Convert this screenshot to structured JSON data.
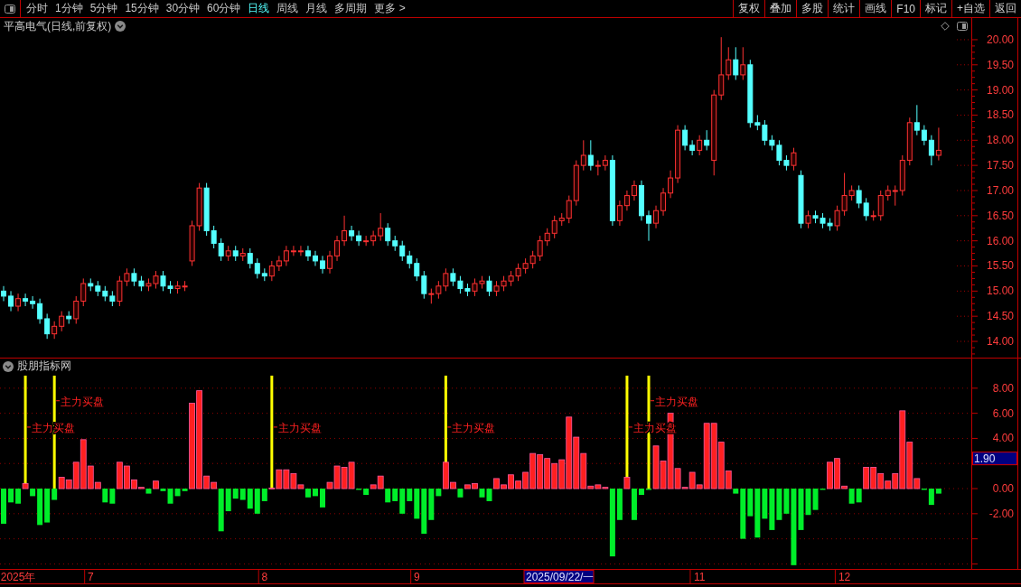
{
  "toolbar": {
    "tabs": [
      {
        "label": "分时",
        "selected": false
      },
      {
        "label": "1分钟",
        "selected": false
      },
      {
        "label": "5分钟",
        "selected": false
      },
      {
        "label": "15分钟",
        "selected": false
      },
      {
        "label": "30分钟",
        "selected": false
      },
      {
        "label": "60分钟",
        "selected": false
      },
      {
        "label": "日线",
        "selected": true
      },
      {
        "label": "周线",
        "selected": false
      },
      {
        "label": "月线",
        "selected": false
      },
      {
        "label": "多周期",
        "selected": false
      },
      {
        "label": "更多 >",
        "selected": false
      }
    ],
    "buttons": [
      "复权",
      "叠加",
      "多股",
      "统计",
      "画线",
      "F10",
      "标记",
      "+自选",
      "返回"
    ]
  },
  "main_chart": {
    "title": "平高电气(日线,前复权)",
    "chart_data": {
      "type": "candlestick",
      "ylim": [
        13.677,
        20.43
      ],
      "yticks": [
        {
          "value": 14,
          "label": "14.00"
        },
        {
          "value": 14.5,
          "label": "14.50"
        },
        {
          "value": 15,
          "label": "15.00"
        },
        {
          "value": 15.5,
          "label": "15.50"
        },
        {
          "value": 16,
          "label": "16.00"
        },
        {
          "value": 16.5,
          "label": "16.50"
        },
        {
          "value": 17,
          "label": "17.00"
        },
        {
          "value": 17.5,
          "label": "17.50"
        },
        {
          "value": 18,
          "label": "18.00"
        },
        {
          "value": 18.5,
          "label": "18.50"
        },
        {
          "value": 19,
          "label": "19.00"
        },
        {
          "value": 19.5,
          "label": "19.50"
        },
        {
          "value": 20,
          "label": "20.00"
        }
      ],
      "categories": [
        null,
        null,
        null,
        null,
        null,
        null,
        null,
        null,
        null,
        null,
        null,
        null,
        null,
        null,
        null,
        null,
        null,
        null,
        null,
        null,
        null,
        null,
        null,
        null,
        null,
        null,
        null,
        null,
        null,
        null,
        null,
        null,
        null,
        null,
        null,
        null,
        null,
        null,
        null,
        null,
        null,
        null,
        null,
        null,
        null,
        null,
        null,
        null,
        null,
        null,
        null,
        null,
        null,
        null,
        null,
        null,
        null,
        null,
        null,
        null,
        null,
        null,
        null,
        null,
        null,
        null,
        null,
        null,
        null,
        null,
        null,
        null,
        null,
        null,
        null,
        null,
        null,
        null,
        null,
        null,
        null,
        null,
        null,
        null,
        null,
        null,
        null,
        null,
        null,
        null,
        null,
        null,
        null,
        null,
        null,
        null,
        null,
        null,
        null,
        null,
        null,
        null,
        null,
        null,
        null,
        null,
        null,
        null,
        null,
        null,
        null,
        null,
        null,
        null,
        null,
        null,
        null,
        null,
        null,
        null,
        null,
        null,
        null,
        null,
        null,
        null,
        null,
        null,
        null,
        null
      ],
      "ohlc": [
        [
          15.0,
          15.1,
          14.8,
          14.9
        ],
        [
          14.9,
          15.0,
          14.6,
          14.7
        ],
        [
          14.7,
          14.95,
          14.6,
          14.85
        ],
        [
          14.85,
          14.95,
          14.7,
          14.8
        ],
        [
          14.8,
          14.9,
          14.65,
          14.75
        ],
        [
          14.75,
          14.85,
          14.35,
          14.45
        ],
        [
          14.45,
          14.55,
          14.05,
          14.15
        ],
        [
          14.15,
          14.4,
          14.05,
          14.3
        ],
        [
          14.3,
          14.6,
          14.2,
          14.5
        ],
        [
          14.5,
          14.6,
          14.35,
          14.45
        ],
        [
          14.45,
          14.9,
          14.35,
          14.8
        ],
        [
          14.8,
          15.25,
          14.7,
          15.15
        ],
        [
          15.15,
          15.25,
          15.0,
          15.1
        ],
        [
          15.1,
          15.2,
          14.9,
          15.0
        ],
        [
          15.0,
          15.1,
          14.8,
          14.9
        ],
        [
          14.9,
          15.0,
          14.7,
          14.8
        ],
        [
          14.8,
          15.3,
          14.7,
          15.2
        ],
        [
          15.2,
          15.45,
          15.1,
          15.35
        ],
        [
          15.35,
          15.45,
          15.1,
          15.2
        ],
        [
          15.2,
          15.3,
          15.0,
          15.1
        ],
        [
          15.1,
          15.25,
          15.0,
          15.15
        ],
        [
          15.15,
          15.4,
          15.05,
          15.3
        ],
        [
          15.3,
          15.4,
          15.0,
          15.1
        ],
        [
          15.1,
          15.2,
          14.95,
          15.05
        ],
        [
          15.05,
          15.2,
          14.95,
          15.1
        ],
        [
          15.1,
          15.2,
          15.0,
          15.1
        ],
        [
          15.6,
          16.4,
          15.5,
          16.3
        ],
        [
          16.3,
          17.15,
          16.2,
          17.05
        ],
        [
          17.05,
          17.15,
          16.1,
          16.2
        ],
        [
          16.2,
          16.3,
          15.85,
          15.95
        ],
        [
          15.95,
          16.05,
          15.6,
          15.7
        ],
        [
          15.7,
          15.9,
          15.6,
          15.8
        ],
        [
          15.8,
          15.9,
          15.6,
          15.7
        ],
        [
          15.7,
          15.85,
          15.6,
          15.75
        ],
        [
          15.75,
          15.85,
          15.45,
          15.55
        ],
        [
          15.55,
          15.65,
          15.25,
          15.35
        ],
        [
          15.35,
          15.45,
          15.2,
          15.3
        ],
        [
          15.3,
          15.6,
          15.2,
          15.5
        ],
        [
          15.5,
          15.7,
          15.4,
          15.6
        ],
        [
          15.6,
          15.9,
          15.5,
          15.8
        ],
        [
          15.8,
          15.9,
          15.7,
          15.8
        ],
        [
          15.8,
          15.9,
          15.7,
          15.8
        ],
        [
          15.8,
          15.9,
          15.6,
          15.7
        ],
        [
          15.7,
          15.8,
          15.5,
          15.6
        ],
        [
          15.6,
          15.7,
          15.35,
          15.45
        ],
        [
          15.45,
          15.8,
          15.35,
          15.7
        ],
        [
          15.7,
          16.1,
          15.6,
          16.0
        ],
        [
          16.0,
          16.5,
          15.9,
          16.2
        ],
        [
          16.2,
          16.3,
          16.0,
          16.1
        ],
        [
          16.1,
          16.2,
          15.9,
          16.0
        ],
        [
          16.0,
          16.1,
          15.9,
          16.0
        ],
        [
          16.0,
          16.2,
          15.9,
          16.1
        ],
        [
          16.1,
          16.55,
          16.0,
          16.25
        ],
        [
          16.25,
          16.35,
          15.9,
          16.0
        ],
        [
          16.0,
          16.1,
          15.8,
          15.9
        ],
        [
          15.9,
          16.0,
          15.6,
          15.7
        ],
        [
          15.7,
          15.8,
          15.45,
          15.55
        ],
        [
          15.55,
          15.65,
          15.2,
          15.3
        ],
        [
          15.3,
          15.4,
          14.85,
          14.95
        ],
        [
          14.95,
          15.05,
          14.75,
          14.95
        ],
        [
          14.95,
          15.2,
          14.85,
          15.1
        ],
        [
          15.1,
          15.45,
          15.0,
          15.35
        ],
        [
          15.35,
          15.45,
          15.1,
          15.2
        ],
        [
          15.2,
          15.3,
          14.95,
          15.05
        ],
        [
          15.05,
          15.15,
          14.9,
          15.0
        ],
        [
          15.0,
          15.25,
          14.9,
          15.15
        ],
        [
          15.15,
          15.3,
          15.05,
          15.2
        ],
        [
          15.2,
          15.3,
          14.9,
          15.0
        ],
        [
          15.0,
          15.2,
          14.9,
          15.1
        ],
        [
          15.1,
          15.3,
          15.0,
          15.2
        ],
        [
          15.2,
          15.4,
          15.1,
          15.3
        ],
        [
          15.3,
          15.55,
          15.2,
          15.45
        ],
        [
          15.45,
          15.65,
          15.35,
          15.55
        ],
        [
          15.55,
          15.8,
          15.45,
          15.7
        ],
        [
          15.7,
          16.1,
          15.6,
          16.0
        ],
        [
          16.0,
          16.25,
          15.9,
          16.15
        ],
        [
          16.15,
          16.5,
          16.05,
          16.4
        ],
        [
          16.4,
          16.55,
          16.3,
          16.45
        ],
        [
          16.45,
          16.9,
          16.35,
          16.8
        ],
        [
          16.8,
          17.6,
          16.7,
          17.5
        ],
        [
          17.5,
          18.0,
          17.4,
          17.7
        ],
        [
          17.7,
          18.0,
          17.4,
          17.5
        ],
        [
          17.5,
          17.6,
          17.3,
          17.5
        ],
        [
          17.5,
          17.7,
          17.4,
          17.6
        ],
        [
          17.6,
          17.7,
          16.3,
          16.4
        ],
        [
          16.4,
          16.8,
          16.3,
          16.7
        ],
        [
          16.7,
          17.0,
          16.6,
          16.9
        ],
        [
          16.9,
          17.2,
          16.8,
          17.1
        ],
        [
          17.1,
          17.2,
          16.4,
          16.5
        ],
        [
          16.5,
          16.6,
          16.0,
          16.35
        ],
        [
          16.35,
          16.7,
          16.25,
          16.6
        ],
        [
          16.6,
          17.05,
          16.5,
          16.95
        ],
        [
          16.95,
          17.4,
          16.85,
          17.25
        ],
        [
          17.25,
          18.3,
          17.15,
          18.2
        ],
        [
          18.2,
          18.3,
          17.8,
          17.9
        ],
        [
          17.9,
          18.0,
          17.7,
          17.8
        ],
        [
          17.8,
          18.1,
          17.7,
          18.0
        ],
        [
          18.0,
          18.2,
          17.8,
          17.9
        ],
        [
          17.6,
          19.0,
          17.3,
          18.9
        ],
        [
          18.9,
          20.05,
          18.8,
          19.3
        ],
        [
          19.3,
          19.85,
          19.2,
          19.6
        ],
        [
          19.6,
          19.85,
          19.2,
          19.3
        ],
        [
          19.3,
          19.85,
          19.2,
          19.5
        ],
        [
          19.5,
          19.6,
          18.25,
          18.35
        ],
        [
          18.35,
          18.5,
          18.2,
          18.3
        ],
        [
          18.3,
          18.4,
          17.9,
          18.0
        ],
        [
          18.0,
          18.1,
          17.8,
          17.9
        ],
        [
          17.9,
          18.0,
          17.5,
          17.6
        ],
        [
          17.6,
          17.7,
          17.4,
          17.5
        ],
        [
          17.5,
          17.85,
          17.4,
          17.75
        ],
        [
          17.3,
          17.4,
          16.25,
          16.35
        ],
        [
          16.35,
          16.6,
          16.25,
          16.5
        ],
        [
          16.5,
          16.6,
          16.35,
          16.45
        ],
        [
          16.45,
          16.55,
          16.25,
          16.35
        ],
        [
          16.35,
          16.45,
          16.2,
          16.3
        ],
        [
          16.3,
          16.7,
          16.2,
          16.6
        ],
        [
          16.6,
          17.35,
          16.5,
          16.9
        ],
        [
          16.9,
          17.1,
          16.8,
          17.0
        ],
        [
          17.0,
          17.1,
          16.65,
          16.75
        ],
        [
          16.75,
          16.85,
          16.4,
          16.5
        ],
        [
          16.5,
          16.6,
          16.4,
          16.5
        ],
        [
          16.5,
          17.0,
          16.4,
          16.9
        ],
        [
          16.9,
          17.1,
          16.8,
          17.0
        ],
        [
          17.0,
          17.1,
          16.7,
          17.0
        ],
        [
          17.0,
          17.7,
          16.9,
          17.6
        ],
        [
          17.6,
          18.45,
          17.5,
          18.35
        ],
        [
          18.35,
          18.7,
          18.1,
          18.2
        ],
        [
          18.2,
          18.3,
          17.9,
          18.0
        ],
        [
          18.0,
          18.1,
          17.5,
          17.7
        ],
        [
          17.7,
          18.25,
          17.6,
          17.8
        ]
      ]
    }
  },
  "indicator": {
    "title": "股朋指标网",
    "current_value": "1.90",
    "date_cursor": "2025/09/22/一",
    "chart_data": {
      "type": "bar",
      "grid": true,
      "ylim": [
        -6.4,
        9.14
      ],
      "yticks": [
        {
          "value": -2,
          "label": "-2.00"
        },
        {
          "value": 0,
          "label": "0.00"
        },
        {
          "value": 4,
          "label": "4.00"
        },
        {
          "value": 6,
          "label": "6.00"
        },
        {
          "value": 8,
          "label": "8.00"
        }
      ],
      "annotations": [
        "主力买盘",
        "主力买盘",
        "主力买盘",
        "主力买盘",
        "主力买盘",
        "主力买盘"
      ],
      "categories": [
        null,
        null,
        "2025年",
        null,
        null,
        null,
        null,
        null,
        null,
        null,
        null,
        null,
        "7",
        null,
        null,
        null,
        null,
        null,
        null,
        null,
        null,
        null,
        null,
        null,
        null,
        null,
        null,
        null,
        null,
        null,
        null,
        null,
        null,
        null,
        null,
        null,
        "8",
        null,
        null,
        null,
        null,
        null,
        null,
        null,
        null,
        null,
        null,
        null,
        null,
        null,
        null,
        null,
        null,
        null,
        null,
        null,
        null,
        "9",
        null,
        null,
        null,
        null,
        null,
        null,
        null,
        null,
        null,
        null,
        null,
        null,
        null,
        null,
        null,
        null,
        null,
        null,
        null,
        null,
        null,
        null,
        null,
        null,
        null,
        null,
        null,
        null,
        null,
        null,
        null,
        null,
        null,
        null,
        null,
        null,
        null,
        null,
        "11",
        null,
        null,
        null,
        null,
        null,
        null,
        null,
        null,
        null,
        null,
        null,
        null,
        null,
        null,
        null,
        null,
        null,
        null,
        null,
        "12",
        null,
        null,
        null,
        null,
        null,
        null,
        null,
        null,
        null,
        null,
        null,
        null,
        null
      ],
      "series": [
        {
          "color": "#ffff00",
          "values": [
            null,
            null,
            null,
            9,
            null,
            null,
            null,
            9,
            null,
            null,
            null,
            null,
            null,
            null,
            null,
            null,
            null,
            null,
            null,
            null,
            null,
            null,
            null,
            null,
            null,
            null,
            null,
            null,
            null,
            null,
            null,
            null,
            null,
            null,
            null,
            null,
            null,
            9,
            null,
            null,
            null,
            null,
            null,
            null,
            null,
            null,
            null,
            null,
            null,
            null,
            null,
            null,
            null,
            null,
            null,
            null,
            null,
            null,
            null,
            null,
            null,
            9,
            null,
            null,
            null,
            null,
            null,
            null,
            null,
            null,
            null,
            null,
            null,
            null,
            null,
            null,
            null,
            null,
            null,
            null,
            null,
            null,
            null,
            null,
            null,
            null,
            9,
            null,
            null,
            9,
            null,
            null,
            null,
            null,
            null,
            null,
            null,
            null,
            null,
            null,
            null,
            null,
            null,
            null,
            null,
            null,
            null,
            null,
            null,
            null,
            null,
            null,
            null,
            null,
            null,
            null,
            null,
            null,
            null,
            null,
            null,
            null,
            null,
            null,
            null,
            null,
            null,
            null,
            null,
            null
          ]
        },
        {
          "colors": [
            "#00ee2a",
            "#00ee2a",
            "#00ee2a",
            "#ff2020",
            "#00ee2a",
            "#00ee2a",
            "#00ee2a",
            "#00ee2a",
            "#ff2020",
            "#ff2020",
            "#ff2020",
            "#ff2020",
            "#ff2020",
            "#ff2020",
            "#00ee2a",
            "#00ee2a",
            "#ff2020",
            "#ff2020",
            "#ff2020",
            "#ff2020",
            "#00ee2a",
            "#ff2020",
            "#00ee2a",
            "#00ee2a",
            "#00ee2a",
            "#00ee2a",
            "#ff2020",
            "#ff2020",
            "#ff2020",
            "#ff2020",
            "#00ee2a",
            "#00ee2a",
            "#00ee2a",
            "#00ee2a",
            "#00ee2a",
            "#00ee2a",
            "#00ee2a",
            "#ff2020",
            "#ff2020",
            "#ff2020",
            "#ff2020",
            "#ff2020",
            "#00ee2a",
            "#00ee2a",
            "#00ee2a",
            "#ff2020",
            "#ff2020",
            "#ff2020",
            "#ff2020",
            "#00ee2a",
            "#00ee2a",
            "#ff2020",
            "#ff2020",
            "#00ee2a",
            "#00ee2a",
            "#00ee2a",
            "#00ee2a",
            "#00ee2a",
            "#00ee2a",
            "#00ee2a",
            "#00ee2a",
            "#ff2020",
            "#ff2020",
            "#00ee2a",
            "#ff2020",
            "#ff2020",
            "#00ee2a",
            "#00ee2a",
            "#ff2020",
            "#ff2020",
            "#ff2020",
            "#ff2020",
            "#ff2020",
            "#ff2020",
            "#ff2020",
            "#ff2020",
            "#ff2020",
            "#ff2020",
            "#ff2020",
            "#ff2020",
            "#ff2020",
            "#ff2020",
            "#ff2020",
            "#ff2020",
            "#00ee2a",
            "#00ee2a",
            "#ff2020",
            "#00ee2a",
            "#00ee2a",
            "#00ee2a",
            "#ff2020",
            "#ff2020",
            "#ff2020",
            "#ff2020",
            "#ff2020",
            "#ff2020",
            "#ff2020",
            "#ff2020",
            "#ff2020",
            "#ff2020",
            "#ff2020",
            "#00ee2a",
            "#00ee2a",
            "#00ee2a",
            "#00ee2a",
            "#00ee2a",
            "#00ee2a",
            "#00ee2a",
            "#00ee2a",
            "#00ee2a",
            "#00ee2a",
            "#00ee2a",
            "#00ee2a",
            "#00ee2a",
            "#ff2020",
            "#ff2020",
            "#ff2020",
            "#00ee2a",
            "#00ee2a",
            "#ff2020",
            "#ff2020",
            "#ff2020",
            "#ff2020",
            "#ff2020",
            "#ff2020",
            "#ff2020",
            "#ff2020",
            "#00ee2a",
            "#00ee2a",
            "#00ee2a"
          ],
          "values": [
            -2.8,
            -1.1,
            -1.2,
            0.4,
            -0.6,
            -2.9,
            -2.7,
            -0.9,
            0.9,
            0.7,
            2.1,
            3.9,
            1.8,
            0.5,
            -1.1,
            -1.2,
            2.1,
            1.8,
            0.7,
            0.1,
            -0.4,
            0.6,
            -0.2,
            -1.2,
            -0.6,
            -0.2,
            6.8,
            7.8,
            1.0,
            0.5,
            -3.4,
            -1.8,
            -0.8,
            -0.9,
            -1.6,
            -2.0,
            -1.0,
            0.05,
            1.5,
            1.5,
            1.2,
            0.3,
            -0.7,
            -0.6,
            -1.5,
            0.5,
            1.8,
            1.7,
            2.1,
            -0.1,
            -0.5,
            0.3,
            1.0,
            -1.1,
            -1.0,
            -2.0,
            -1.0,
            -2.4,
            -3.6,
            -2.5,
            -0.6,
            2.1,
            0.5,
            -0.7,
            0.3,
            0.4,
            -0.7,
            -1.0,
            0.8,
            0.3,
            1.1,
            0.6,
            1.3,
            2.8,
            2.7,
            2.4,
            2.0,
            2.3,
            5.7,
            4.1,
            2.8,
            0.2,
            0.3,
            0.1,
            -5.4,
            -2.5,
            0.9,
            -2.5,
            -0.5,
            -0.1,
            3.4,
            2.2,
            6.0,
            1.6,
            0.1,
            1.3,
            0.3,
            5.2,
            5.2,
            3.7,
            1.4,
            -0.4,
            -4.0,
            -2.2,
            -3.9,
            -2.4,
            -3.3,
            -2.5,
            -2.0,
            -6.1,
            -3.3,
            -2.1,
            -1.7,
            -0.1,
            2.1,
            2.4,
            0.2,
            -1.2,
            -1.1,
            1.7,
            1.7,
            1.2,
            0.6,
            1.2,
            6.2,
            3.7,
            0.8,
            -0.1,
            -1.3,
            -0.4
          ]
        }
      ]
    }
  }
}
